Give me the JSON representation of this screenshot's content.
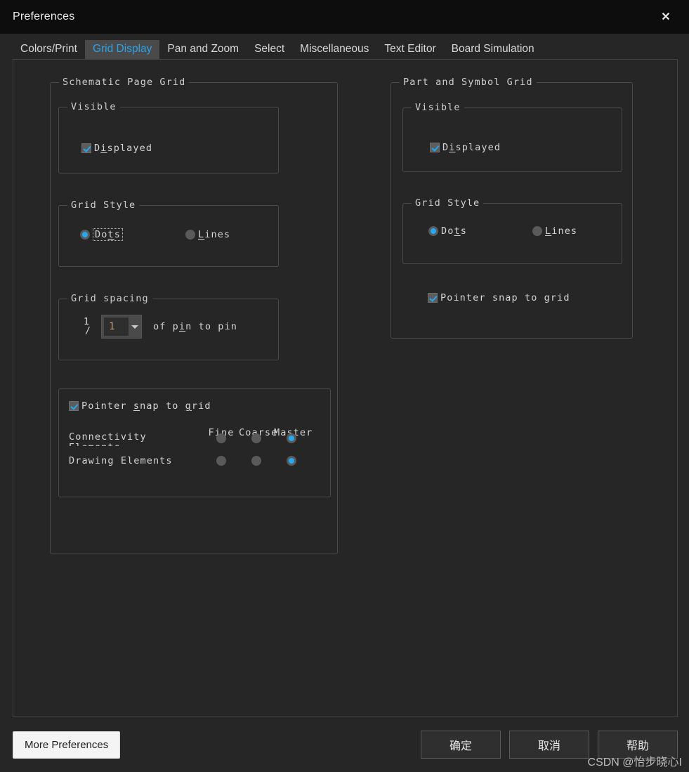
{
  "window": {
    "title": "Preferences",
    "close_icon": "close-icon"
  },
  "tabs": [
    {
      "label": "Colors/Print",
      "active": false
    },
    {
      "label": "Grid Display",
      "active": true
    },
    {
      "label": "Pan and Zoom",
      "active": false
    },
    {
      "label": "Select",
      "active": false
    },
    {
      "label": "Miscellaneous",
      "active": false
    },
    {
      "label": "Text Editor",
      "active": false
    },
    {
      "label": "Board Simulation",
      "active": false
    }
  ],
  "schematic": {
    "legend": "Schematic Page Grid",
    "visible": {
      "legend": "Visible",
      "displayed_label_a": "D",
      "displayed_label_b": "i",
      "displayed_label_c": "splayed",
      "displayed_checked": true
    },
    "grid_style": {
      "legend": "Grid Style",
      "dots_a": "Do",
      "dots_b": "t",
      "dots_c": "s",
      "lines_a": "L",
      "lines_b": "i",
      "lines_c": "nes",
      "selected": "Dots"
    },
    "grid_spacing": {
      "legend": "Grid spacing",
      "numerator": "1",
      "slash": "/",
      "combo_value": "1",
      "suffix_a": "of p",
      "suffix_b": "i",
      "suffix_c": "n to pin"
    },
    "snap": {
      "checkbox_a": "Pointer ",
      "checkbox_b": "s",
      "checkbox_c": "nap to ",
      "checkbox_d": "g",
      "checkbox_e": "rid",
      "checked": true,
      "columns": [
        "Fine",
        "Coarse",
        "Master"
      ],
      "rows": [
        {
          "label": "Connectivity",
          "label_clipped": "Elements",
          "selected": "Master"
        },
        {
          "label": "Drawing Elements",
          "label_clipped": "",
          "selected": "Master"
        }
      ]
    }
  },
  "part_symbol": {
    "legend": "Part and Symbol Grid",
    "visible": {
      "legend": "Visible",
      "displayed_label_a": "D",
      "displayed_label_b": "i",
      "displayed_label_c": "splayed",
      "displayed_checked": true
    },
    "grid_style": {
      "legend": "Grid Style",
      "dots_a": "Do",
      "dots_b": "t",
      "dots_c": "s",
      "lines_a": "L",
      "lines_b": "i",
      "lines_c": "nes",
      "selected": "Dots"
    },
    "snap": {
      "checkbox_a": "Pointer ",
      "checkbox_b": "s",
      "checkbox_c": "nap to ",
      "checkbox_d": "g",
      "checkbox_e": "rid",
      "checked": true
    }
  },
  "footer": {
    "more_preferences": "More Preferences",
    "ok": "确定",
    "cancel": "取消",
    "help": "帮助"
  },
  "watermark": "CSDN @怡步晓心I",
  "colors": {
    "accent_blue": "#26a8f2",
    "tab_active_text": "#2aa4e8",
    "dialog_bg": "#262626",
    "titlebar_bg": "#0d0d0d",
    "group_border": "#4b4b4b"
  }
}
